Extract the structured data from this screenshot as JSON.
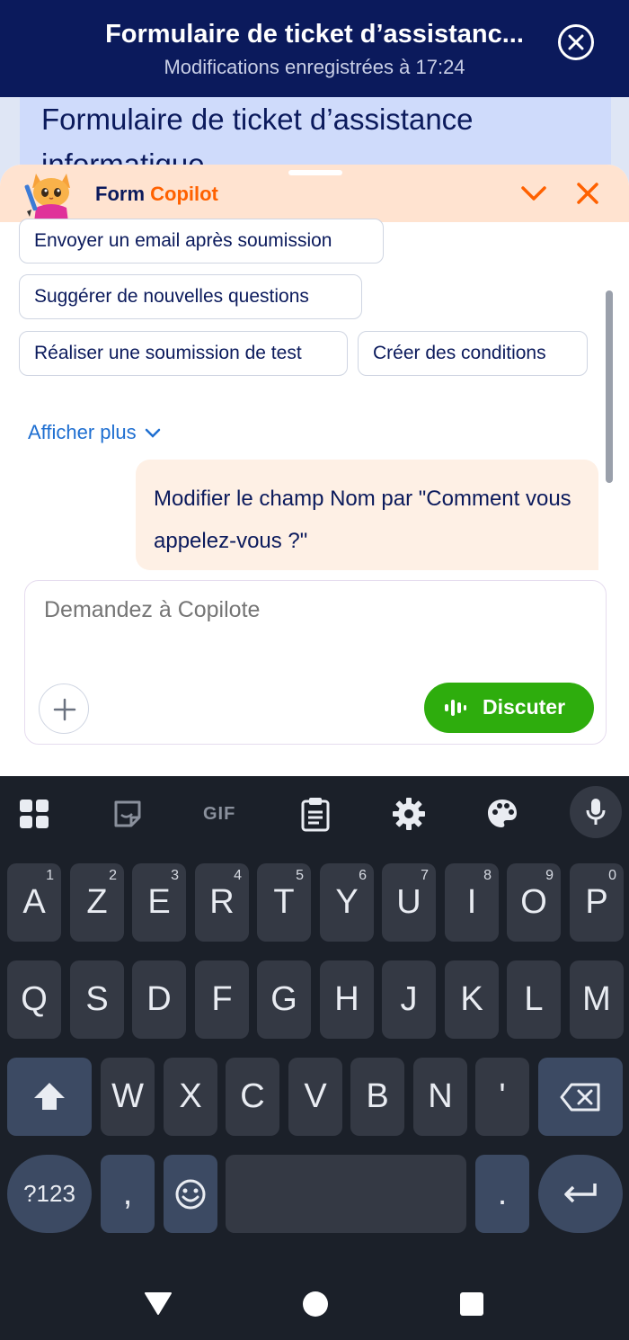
{
  "header": {
    "title": "Formulaire de ticket d’assistanc...",
    "subtitle": "Modifications enregistrées à 17:24"
  },
  "form_preview": {
    "title": "Formulaire de ticket d’assistance informatique"
  },
  "copilot": {
    "brand_prefix": "Form",
    "brand_accent": "Copilot",
    "suggestions": [
      "Envoyer un email après soumission",
      "Suggérer de nouvelles questions",
      "Réaliser une soumission de test",
      "Créer des conditions"
    ],
    "show_more_label": "Afficher plus",
    "message_text": "Modifier le champ Nom par \"Comment vous appelez-vous ?\"",
    "input_placeholder": "Demandez à Copilote",
    "chat_button_label": "Discuter"
  },
  "keyboard": {
    "toolbar_icons": [
      "apps-grid-icon",
      "sticker-icon",
      "gif-icon",
      "clipboard-icon",
      "gear-icon",
      "palette-icon",
      "microphone-icon"
    ],
    "gif_label": "GIF",
    "row1": [
      {
        "key": "A",
        "hint": "1"
      },
      {
        "key": "Z",
        "hint": "2"
      },
      {
        "key": "E",
        "hint": "3"
      },
      {
        "key": "R",
        "hint": "4"
      },
      {
        "key": "T",
        "hint": "5"
      },
      {
        "key": "Y",
        "hint": "6"
      },
      {
        "key": "U",
        "hint": "7"
      },
      {
        "key": "I",
        "hint": "8"
      },
      {
        "key": "O",
        "hint": "9"
      },
      {
        "key": "P",
        "hint": "0"
      }
    ],
    "row2": [
      "Q",
      "S",
      "D",
      "F",
      "G",
      "H",
      "J",
      "K",
      "L",
      "M"
    ],
    "row3": [
      "W",
      "X",
      "C",
      "V",
      "B",
      "N",
      "'"
    ],
    "symbols_label": "?123",
    "comma_label": ",",
    "period_label": "."
  },
  "colors": {
    "header_bg": "#0b1a5c",
    "copilot_accent": "#ff6100",
    "chat_button": "#2ead0d",
    "link_blue": "#1f6fd1"
  }
}
